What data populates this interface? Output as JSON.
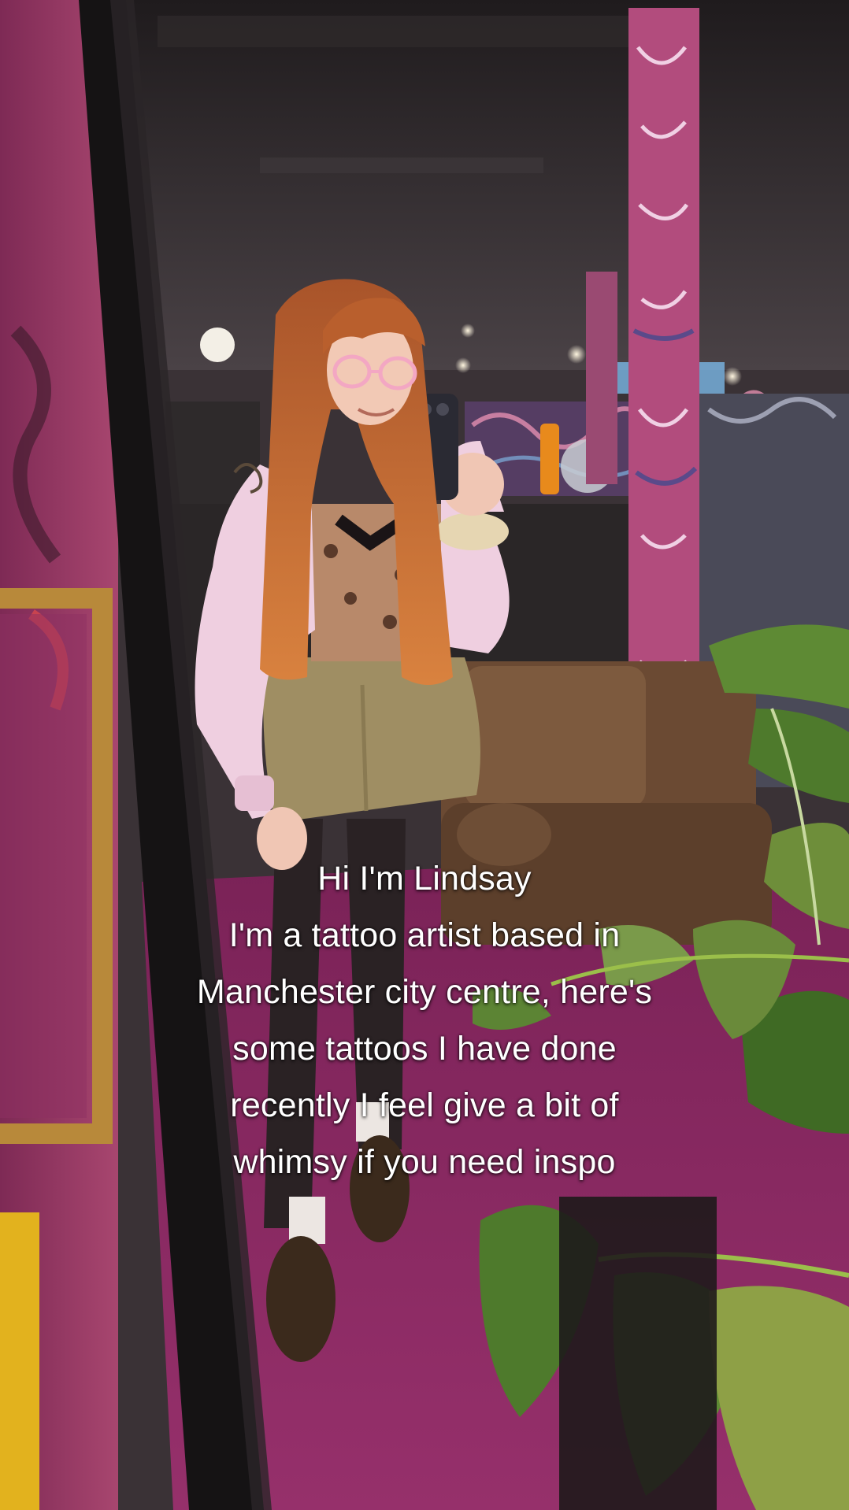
{
  "caption": {
    "lines": [
      "Hi I'm Lindsay",
      "I'm a tattoo artist based in",
      "Manchester city centre, here's",
      "some tattoos I have done",
      "recently I feel give a bit of",
      "whimsy if you need inspo"
    ]
  },
  "colors": {
    "floor": "#8a2a62",
    "ceiling": "#2a2528",
    "wall": "#3a3236",
    "mirror_frame": "#1c1a1b",
    "gold_frame": "#b8893a",
    "sweater": "#efcfe0",
    "hair": "#c4672f",
    "shorts": "#9f8e63",
    "sofa": "#6b4a33",
    "plant": "#4f7a2e",
    "caption_text": "#ffffff"
  }
}
